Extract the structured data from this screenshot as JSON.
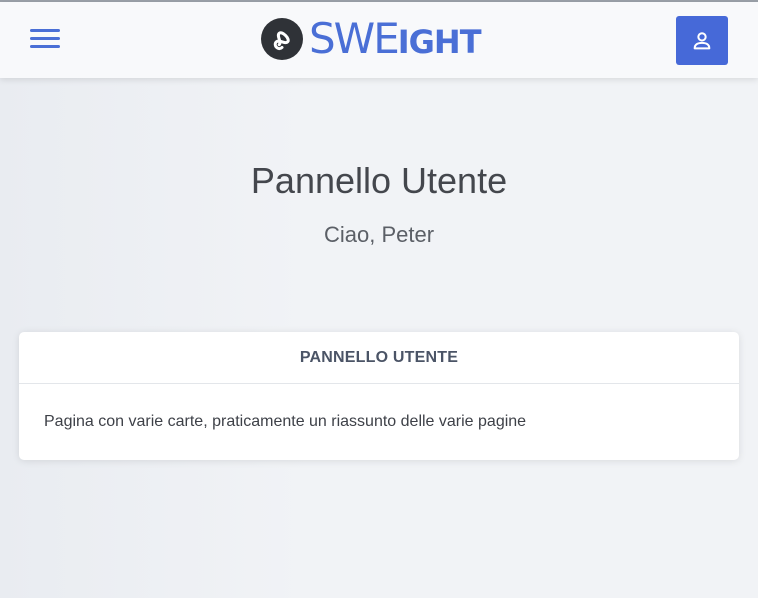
{
  "brand": {
    "logo_big": "SWE",
    "logo_small": "IGHT",
    "accent_color": "#4a6fd6"
  },
  "navbar": {
    "menu_icon": "hamburger-menu-icon",
    "user_icon": "user-icon"
  },
  "page": {
    "title": "Pannello Utente",
    "greeting": "Ciao, Peter"
  },
  "card": {
    "header": "PANNELLO UTENTE",
    "body": "Pagina con varie carte, praticamente un riassunto delle varie pagine"
  }
}
